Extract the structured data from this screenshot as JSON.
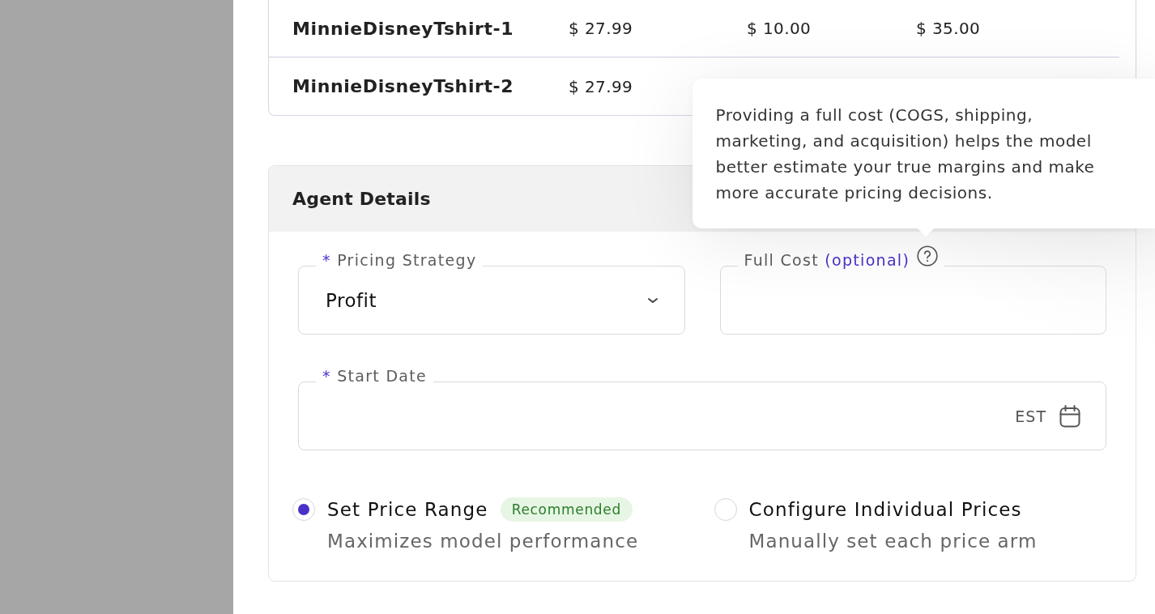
{
  "products_table": {
    "rows": [
      {
        "cells": [
          "MinnieDisneyTshirt-1",
          "$ 27.99",
          "$ 10.00",
          "$ 35.00"
        ]
      },
      {
        "cells": [
          "MinnieDisneyTshirt-2",
          "$ 27.99"
        ]
      }
    ]
  },
  "agent_details": {
    "title": "Agent Details",
    "fields": [
      {
        "kind": "select",
        "required_mark": "*",
        "label": "Pricing Strategy",
        "value": "Profit"
      },
      {
        "kind": "text",
        "label": "Full Cost",
        "optional_note": "(optional)",
        "tooltip": {
          "open": true,
          "text": "Providing a full cost (COGS, shipping, marketing, and acquisition) helps the model better estimate your true margins and make more accurate pricing decisions."
        }
      },
      {
        "kind": "date",
        "required_mark": "*",
        "label": "Start Date",
        "suffix": "EST"
      }
    ],
    "price_mode": {
      "options": [
        {
          "label": "Set Price Range",
          "badge": "Recommended",
          "description": "Maximizes model performance",
          "selected": true
        },
        {
          "label": "Configure Individual Prices",
          "description": "Manually set each price arm",
          "selected": false
        }
      ]
    }
  }
}
